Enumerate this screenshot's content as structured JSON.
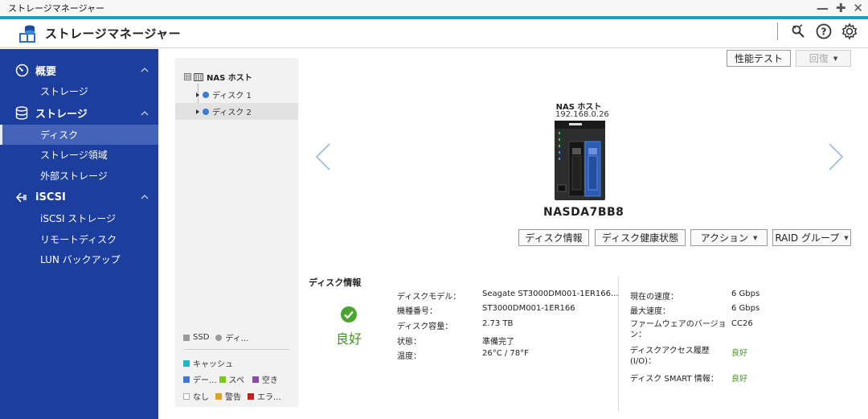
{
  "window": {
    "title": "ストレージマネージャー",
    "controls": [
      "—",
      "✚",
      "✕"
    ]
  },
  "header": {
    "title": "ストレージマネージャー"
  },
  "sidebar": {
    "sections": [
      {
        "label": "概要",
        "items": [
          "ストレージ"
        ]
      },
      {
        "label": "ストレージ",
        "items": [
          "ディスク",
          "ストレージ領域",
          "外部ストレージ"
        ]
      },
      {
        "label": "iSCSI",
        "items": [
          "iSCSI ストレージ",
          "リモートディスク",
          "LUN バックアップ"
        ]
      }
    ],
    "active_item": "ディスク"
  },
  "tree": {
    "root": "NAS ホスト",
    "root_toggle": "⊟",
    "disks": [
      "ディスク 1",
      "ディスク 2"
    ],
    "selected": "ディスク 2"
  },
  "legend": {
    "types": [
      {
        "label": "SSD",
        "color": "#9a9a9a"
      },
      {
        "label": "ディ...",
        "color": "#9a9a9a"
      }
    ],
    "usage": [
      {
        "label": "キャッシュ",
        "color": "#22b8c8"
      },
      {
        "label": "デー...",
        "color": "#3c7ad6"
      },
      {
        "label": "スペ",
        "color": "#7ac81e"
      },
      {
        "label": "空き",
        "color": "#8a4ab0"
      },
      {
        "label": "なし",
        "color": "#ffffff"
      },
      {
        "label": "警告",
        "color": "#e0a020"
      },
      {
        "label": "エラ...",
        "color": "#c02020"
      }
    ]
  },
  "toolbar": {
    "perf_test": "性能テスト",
    "recover": "回復"
  },
  "device": {
    "name": "NAS ホスト",
    "ip": "192.168.0.26",
    "model": "NASDA7BB8"
  },
  "actions": {
    "disk_info": "ディスク情報",
    "disk_health": "ディスク健康状態",
    "action": "アクション",
    "raid_group": "RAID グループ"
  },
  "disk_info": {
    "title": "ディスク情報",
    "status": "良好",
    "left": [
      {
        "label": "ディスクモデル：",
        "value": "Seagate ST3000DM001-1ER166..."
      },
      {
        "label": "機種番号：",
        "value": "ST3000DM001-1ER166"
      },
      {
        "label": "ディスク容量：",
        "value": "2.73 TB"
      },
      {
        "label": "状態：",
        "value": "準備完了"
      },
      {
        "label": "温度：",
        "value": "26°C / 78°F"
      }
    ],
    "right": [
      {
        "label": "現在の速度：",
        "value": "6 Gbps"
      },
      {
        "label": "最大速度：",
        "value": "6 Gbps"
      },
      {
        "label": "ファームウェアのバージョン：",
        "value": "CC26"
      },
      {
        "label": "ディスクアクセス履歴 (I/O)：",
        "value": "良好"
      },
      {
        "label": "ディスク SMART 情報：",
        "value": "良好"
      }
    ]
  }
}
